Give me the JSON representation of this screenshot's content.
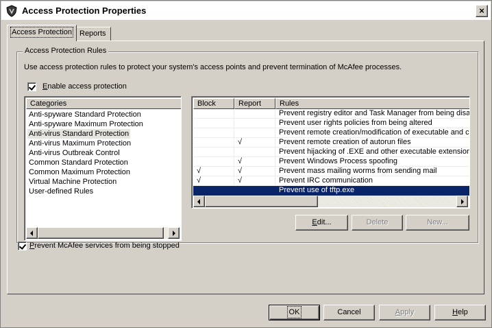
{
  "window": {
    "title": "Access Protection Properties",
    "close_glyph": "×",
    "title_icon": "mcafee-shield-icon"
  },
  "tabs": [
    {
      "label": "Access Protection",
      "active": true
    },
    {
      "label": "Reports",
      "active": false
    }
  ],
  "group": {
    "title": "Access Protection Rules",
    "description": "Use access protection rules to protect your system's access points and prevent termination of McAfee processes."
  },
  "enable_access_protection": {
    "checked": true,
    "label_prefix": "E",
    "label_rest": "nable access protection"
  },
  "categories": {
    "header": "Categories",
    "selected_index": 2,
    "items": [
      "Anti-spyware Standard Protection",
      "Anti-spyware Maximum Protection",
      "Anti-virus Standard Protection",
      "Anti-virus Maximum Protection",
      "Anti-virus Outbreak Control",
      "Common Standard Protection",
      "Common Maximum Protection",
      "Virtual Machine Protection",
      "User-defined Rules"
    ]
  },
  "rules": {
    "columns": [
      "Block",
      "Report",
      "Rules"
    ],
    "selected_index": 8,
    "check_glyph": "√",
    "rows": [
      {
        "block": "",
        "report": "",
        "rule": "Prevent registry editor and Task Manager from being disabled"
      },
      {
        "block": "",
        "report": "",
        "rule": "Prevent user rights policies from being altered"
      },
      {
        "block": "",
        "report": "",
        "rule": "Prevent remote creation/modification of executable and configuration files"
      },
      {
        "block": "",
        "report": "√",
        "rule": "Prevent remote creation of autorun files"
      },
      {
        "block": "",
        "report": "",
        "rule": "Prevent hijacking of .EXE and other executable extensions"
      },
      {
        "block": "",
        "report": "√",
        "rule": "Prevent Windows Process spoofing"
      },
      {
        "block": "√",
        "report": "√",
        "rule": "Prevent mass mailing worms from sending mail"
      },
      {
        "block": "√",
        "report": "√",
        "rule": "Prevent IRC communication"
      },
      {
        "block": "",
        "report": "",
        "rule": "Prevent use of tftp.exe"
      }
    ]
  },
  "rule_buttons": {
    "edit_u": "E",
    "edit_rest": "dit...",
    "delete": "Delete",
    "new": "New..."
  },
  "prevent_stop": {
    "checked": true,
    "label_prefix": "P",
    "label_rest": "revent McAfee services from being stopped"
  },
  "footer": {
    "ok": "OK",
    "cancel": "Cancel",
    "apply_u": "A",
    "apply_rest": "pply",
    "help_u": "H",
    "help_rest": "elp"
  }
}
